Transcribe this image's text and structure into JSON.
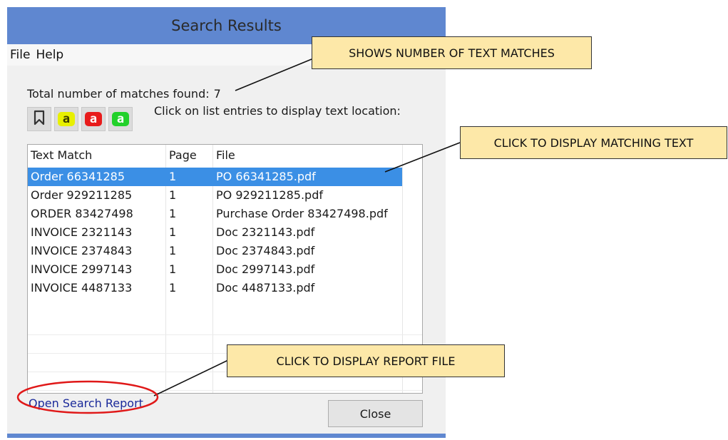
{
  "window": {
    "title": "Search Results"
  },
  "menu": [
    "File",
    "Help"
  ],
  "total": {
    "label": "Total number of matches found:",
    "count": "7"
  },
  "toolbar": {
    "buttons": [
      {
        "icon": "bookmark-icon"
      },
      {
        "icon": "highlight-yellow-icon",
        "glyph": "a",
        "color": "#e8f000"
      },
      {
        "icon": "highlight-red-icon",
        "glyph": "a",
        "color": "#e81b1b"
      },
      {
        "icon": "highlight-green-icon",
        "glyph": "a",
        "color": "#22d12a"
      }
    ],
    "instruction": "Click on list entries to display text location:"
  },
  "results": {
    "columns": [
      "Text Match",
      "Page",
      "File"
    ],
    "rows": [
      {
        "text": "Order 66341285",
        "page": "1",
        "file": "PO 66341285.pdf",
        "selected": true
      },
      {
        "text": "Order 929211285",
        "page": "1",
        "file": "PO 929211285.pdf"
      },
      {
        "text": "ORDER 83427498",
        "page": "1",
        "file": "Purchase Order 83427498.pdf"
      },
      {
        "text": "INVOICE 2321143",
        "page": "1",
        "file": "Doc 2321143.pdf"
      },
      {
        "text": "INVOICE 2374843",
        "page": "1",
        "file": "Doc 2374843.pdf"
      },
      {
        "text": "INVOICE 2997143",
        "page": "1",
        "file": "Doc 2997143.pdf"
      },
      {
        "text": "INVOICE 4487133",
        "page": "1",
        "file": "Doc 4487133.pdf"
      }
    ]
  },
  "footer": {
    "report_link": "Open Search Report",
    "close_label": "Close"
  },
  "callouts": {
    "matches": "SHOWS NUMBER OF TEXT MATCHES",
    "display_text": "CLICK TO DISPLAY MATCHING TEXT",
    "report": "CLICK TO DISPLAY REPORT FILE"
  },
  "colors": {
    "title_bar": "#5f87d0",
    "selection": "#3b8fe5",
    "callout_fill": "#fde8a8",
    "link": "#1a2a9a",
    "annotation_circle": "#e01818"
  }
}
